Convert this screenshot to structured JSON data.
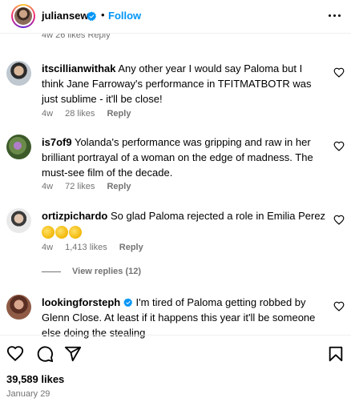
{
  "header": {
    "username": "juliansew",
    "separator": "•",
    "follow_label": "Follow"
  },
  "clipped_meta": "4w   26 likes   Reply",
  "comments": [
    {
      "username": "itscillianwithak",
      "text": "Any other year I would say Paloma but I think Jane Farroway's performance in TFITMATBOTR was just sublime - it'll be close!",
      "time": "4w",
      "likes": "28 likes",
      "reply": "Reply"
    },
    {
      "username": "is7of9",
      "text": "Yolanda's performance was gripping and raw in her brilliant portrayal of a woman on the edge of madness. The must-see film of the decade.",
      "time": "4w",
      "likes": "72 likes",
      "reply": "Reply"
    },
    {
      "username": "ortizpichardo",
      "text": "So glad Paloma rejected a role in Emilia Perez",
      "emoji": "👏👏👏",
      "time": "4w",
      "likes": "1,413 likes",
      "reply": "Reply"
    },
    {
      "username": "lookingforsteph",
      "text": "I'm tired of Paloma getting robbed by Glenn Close. At least if it happens this year it'll be someone else doing the stealing",
      "verified": true
    }
  ],
  "view_replies": "View replies (12)",
  "footer": {
    "likes": "39,589 likes",
    "date": "January 29"
  },
  "colors": {
    "link_blue": "#0095f6",
    "verified_blue": "#0095f6",
    "muted_gray": "#737373"
  },
  "icons": [
    "verified-badge-icon",
    "more-options-icon",
    "heart-icon",
    "comment-icon",
    "share-icon",
    "bookmark-icon"
  ]
}
